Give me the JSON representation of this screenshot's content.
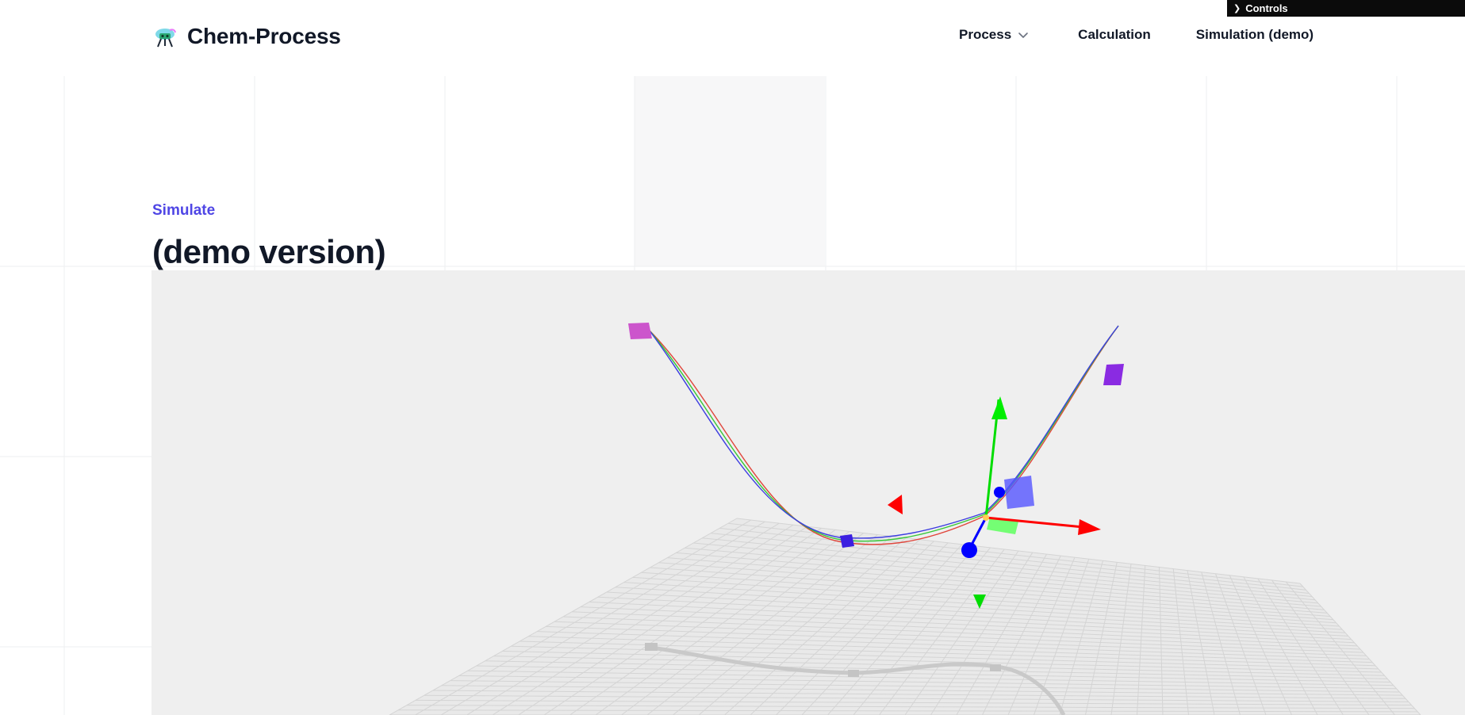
{
  "header": {
    "brand_name": "Chem-Process",
    "nav": {
      "process_label": "Process",
      "calculation_label": "Calculation",
      "simulation_label": "Simulation (demo)"
    },
    "controls_label": "Controls"
  },
  "hero": {
    "eyebrow": "Simulate",
    "title": "(demo version)"
  },
  "scene": {
    "colors": {
      "background": "#efefef",
      "x_axis": "#ff0000",
      "y_axis": "#00ff00",
      "z_axis": "#0000ff",
      "curve_red": "#e0463c",
      "curve_green": "#37c837",
      "curve_blue": "#3c3ce0",
      "control_point_start": "#cc55cc",
      "control_point_mid": "#3b1fe0",
      "control_point_end": "#8a2be2",
      "grid": "#d4d4d4"
    }
  }
}
